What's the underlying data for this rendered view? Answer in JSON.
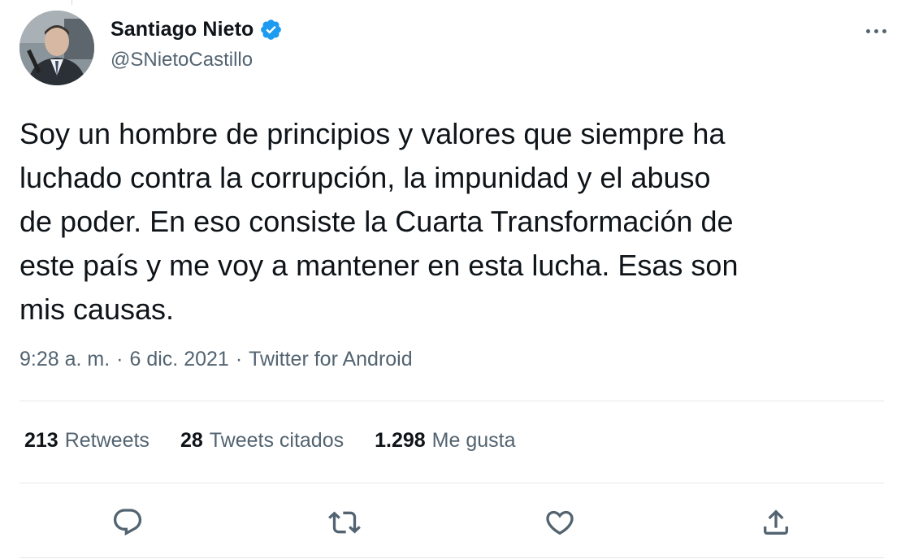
{
  "author": {
    "display_name": "Santiago Nieto",
    "handle": "@SNietoCastillo",
    "verified": true
  },
  "tweet": {
    "text": "Soy un hombre de principios y valores que siempre ha\nluchado contra la corrupción, la impunidad y el abuso\nde poder. En eso consiste la Cuarta Transformación de\neste país y me voy a mantener en esta lucha. Esas son\nmis causas.",
    "time": "9:28 a. m.",
    "date": "6 dic. 2021",
    "source": "Twitter for Android",
    "separator": "·"
  },
  "stats": {
    "retweets": {
      "count": "213",
      "label": "Retweets"
    },
    "quotes": {
      "count": "28",
      "label": "Tweets citados"
    },
    "likes": {
      "count": "1.298",
      "label": "Me gusta"
    }
  },
  "actions": [
    "reply-icon",
    "retweet-icon",
    "like-icon",
    "share-icon"
  ],
  "colors": {
    "text_primary": "#0f1419",
    "text_secondary": "#536471",
    "verified_blue": "#1d9bf0",
    "divider": "#e3e8ec"
  }
}
